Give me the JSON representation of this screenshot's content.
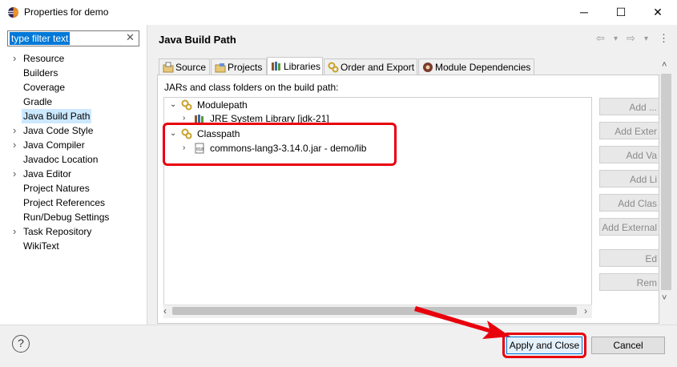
{
  "window": {
    "title": "Properties for demo",
    "minimize": "─",
    "maximize": "☐",
    "close": "✕"
  },
  "filter": {
    "value": "type filter text",
    "clear_glyph": "✕"
  },
  "nav": {
    "items": [
      {
        "label": "Resource",
        "expandable": true
      },
      {
        "label": "Builders",
        "expandable": false
      },
      {
        "label": "Coverage",
        "expandable": false
      },
      {
        "label": "Gradle",
        "expandable": false
      },
      {
        "label": "Java Build Path",
        "expandable": false,
        "selected": true
      },
      {
        "label": "Java Code Style",
        "expandable": true
      },
      {
        "label": "Java Compiler",
        "expandable": true
      },
      {
        "label": "Javadoc Location",
        "expandable": false
      },
      {
        "label": "Java Editor",
        "expandable": true
      },
      {
        "label": "Project Natures",
        "expandable": false
      },
      {
        "label": "Project References",
        "expandable": false
      },
      {
        "label": "Run/Debug Settings",
        "expandable": false
      },
      {
        "label": "Task Repository",
        "expandable": true
      },
      {
        "label": "WikiText",
        "expandable": false
      }
    ]
  },
  "page": {
    "title": "Java Build Path",
    "nav_glyphs": {
      "back": "⇦",
      "forward": "⇨",
      "dropdown": "▾",
      "menu": "⋮"
    }
  },
  "tabs": [
    {
      "label": "Source"
    },
    {
      "label": "Projects"
    },
    {
      "label": "Libraries",
      "active": true
    },
    {
      "label": "Order and Export"
    },
    {
      "label": "Module Dependencies"
    }
  ],
  "libraries": {
    "description": "JARs and class folders on the build path:",
    "tree": {
      "modulepath": {
        "label": "Modulepath",
        "child": "JRE System Library [jdk-21]"
      },
      "classpath": {
        "label": "Classpath",
        "child": "commons-lang3-3.14.0.jar - demo/lib"
      }
    },
    "buttons": [
      "Add ...",
      "Add Exter",
      "Add Va",
      "Add Li",
      "Add Clas",
      "Add External",
      "Ed",
      "Rem"
    ]
  },
  "scroll_glyphs": {
    "left": "‹",
    "right": "›",
    "up": "˄",
    "down": "˅"
  },
  "footer": {
    "help": "?",
    "apply_close": "Apply and Close",
    "cancel": "Cancel"
  },
  "colors": {
    "highlight": "#e8000d",
    "selection": "#0078d7",
    "nav_selected": "#cce8ff"
  }
}
